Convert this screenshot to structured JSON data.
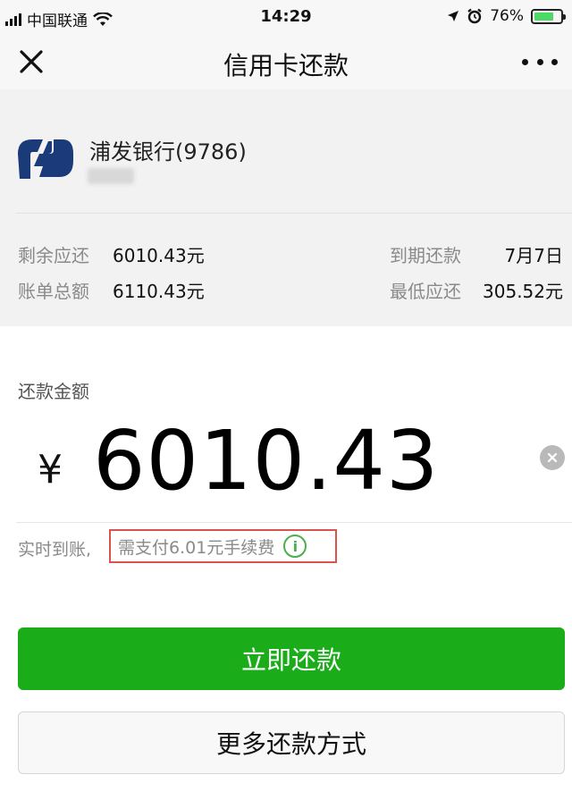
{
  "status_bar": {
    "carrier": "中国联通",
    "time": "14:29",
    "battery_percent": "76%",
    "battery_level": 0.76,
    "icons": [
      "signal-icon",
      "wifi-icon",
      "location-icon",
      "alarm-icon",
      "battery-icon"
    ]
  },
  "nav": {
    "title": "信用卡还款",
    "close_icon": "close-icon",
    "more_icon": "more-icon"
  },
  "card": {
    "bank_name": "浦发银行(9786)",
    "logo": "spd-bank-logo",
    "remaining_label": "剩余应还",
    "remaining_value": "6010.43元",
    "due_label": "到期还款",
    "due_value": "7月7日",
    "bill_label": "账单总额",
    "bill_value": "6110.43元",
    "min_label": "最低应还",
    "min_value": "305.52元"
  },
  "payment": {
    "amount_label": "还款金额",
    "currency_symbol": "¥",
    "amount": "6010.43",
    "realtime_text": "实时到账,",
    "fee_text": "需支付6.01元手续费",
    "info_icon": "info-icon"
  },
  "buttons": {
    "repay_now": "立即还款",
    "more_methods": "更多还款方式"
  },
  "colors": {
    "primary_green": "#1aad19",
    "highlight_red": "#d9534f",
    "panel_gray": "#f2f2f2",
    "bank_blue": "#1b3a7a"
  }
}
